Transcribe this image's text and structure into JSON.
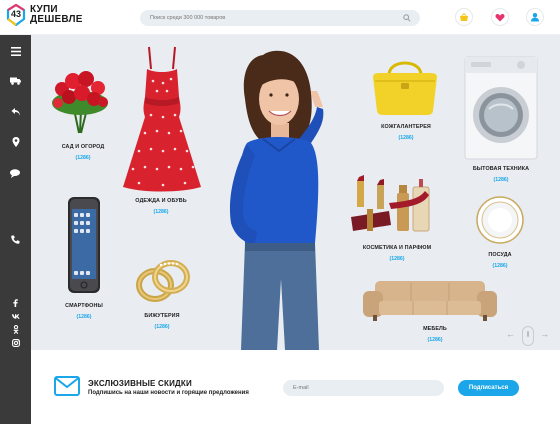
{
  "header": {
    "logo_number": "43",
    "logo_line1": "КУПИ",
    "logo_line2": "ДЕШЕВЛЕ",
    "search_placeholder": "Поиск среди 300 000 товаров",
    "icons": [
      "basket-icon",
      "heart-icon",
      "user-icon"
    ]
  },
  "sidebar": {
    "icons": [
      "menu-icon",
      "truck-icon",
      "return-icon",
      "location-icon",
      "chat-icon",
      "phone-icon",
      "facebook-icon",
      "vk-icon",
      "odnoklassniki-icon",
      "instagram-icon"
    ]
  },
  "categories": [
    {
      "name": "САД И ОГОРОД",
      "count": "(1286)"
    },
    {
      "name": "ОДЕЖДА И ОБУВЬ",
      "count": "(1286)"
    },
    {
      "name": "СМАРТФОНЫ",
      "count": "(1286)"
    },
    {
      "name": "БИЖУТЕРИЯ",
      "count": "(1286)"
    },
    {
      "name": "КОЖГАЛАНТЕРЕЯ",
      "count": "(1286)"
    },
    {
      "name": "БЫТОВАЯ ТЕХНИКА",
      "count": "(1286)"
    },
    {
      "name": "КОСМЕТИКА И ПАРФЮМ",
      "count": "(1286)"
    },
    {
      "name": "ПОСУДА",
      "count": "(1286)"
    },
    {
      "name": "МЕБЕЛЬ",
      "count": "(1286)"
    }
  ],
  "subscribe": {
    "title": "ЭКСЛЮЗИВНЫЕ СКИДКИ",
    "subtitle": "Подпишись на наши новости и горящие предложения",
    "email_placeholder": "E-mail",
    "button_label": "Подписаться"
  },
  "colors": {
    "accent": "#1aa6e8",
    "sidebar": "#3a3a3a",
    "hero_bg": "#e9edf2",
    "basket": "#f5c518",
    "heart": "#e8336d",
    "user": "#1aa6e8"
  }
}
